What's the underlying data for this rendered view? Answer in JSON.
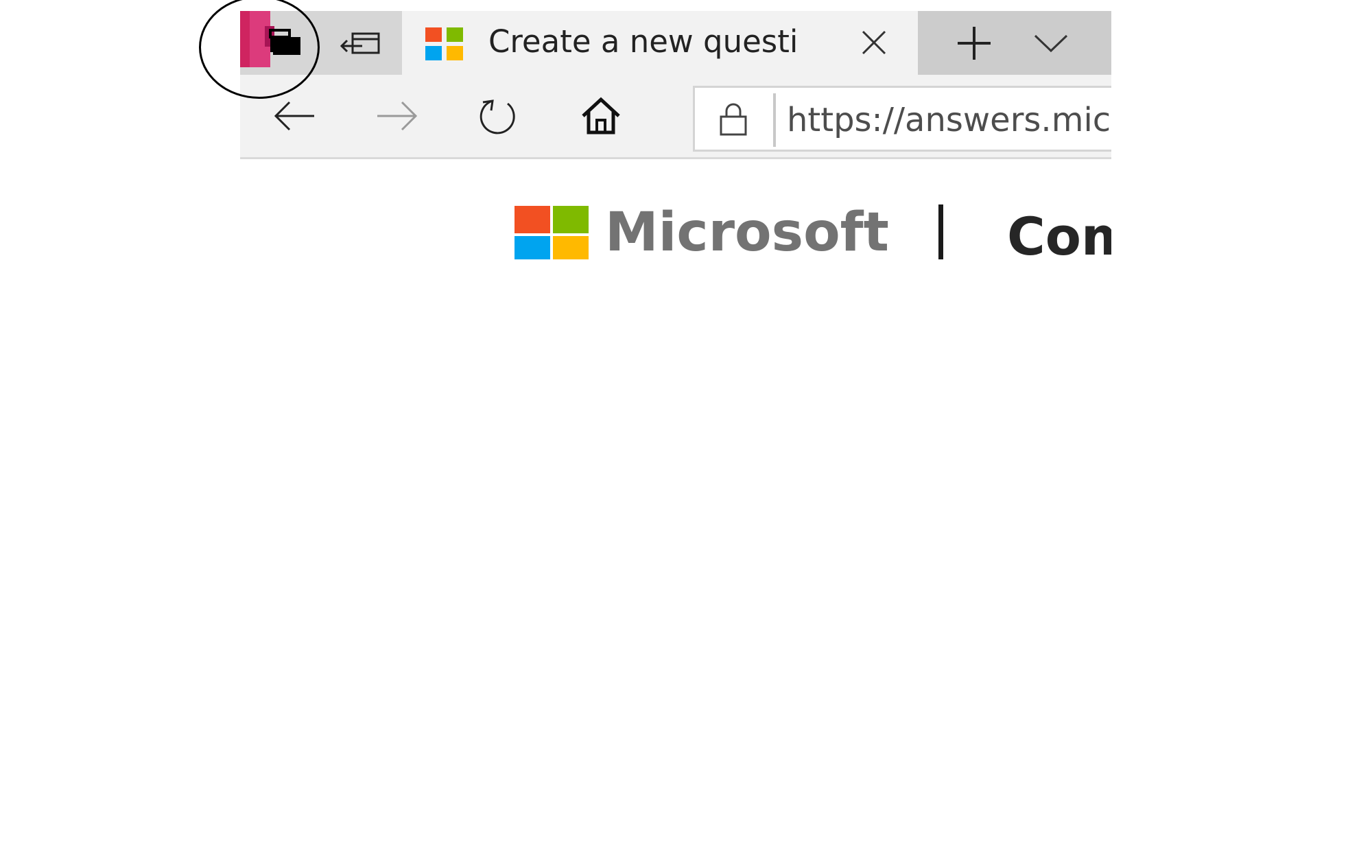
{
  "tab": {
    "title": "Create a new questi",
    "favicon": "microsoft-logo-icon"
  },
  "tabbar_icons": {
    "set_aside": "set-tabs-aside-icon",
    "restore": "restore-tabs-icon",
    "close": "close-icon",
    "new_tab": "plus-icon",
    "tab_list": "chevron-down-icon"
  },
  "toolbar": {
    "back_icon": "arrow-left-icon",
    "forward_icon": "arrow-right-icon",
    "refresh_icon": "refresh-icon",
    "home_icon": "home-icon",
    "lock_icon": "lock-icon",
    "url": "https://answers.mic"
  },
  "site": {
    "brand": "Microsoft",
    "section": "Com"
  },
  "colors": {
    "ms_red": "#f25022",
    "ms_green": "#7fba00",
    "ms_blue": "#00a4ef",
    "ms_yellow": "#ffb900",
    "highlight": "#000000"
  }
}
